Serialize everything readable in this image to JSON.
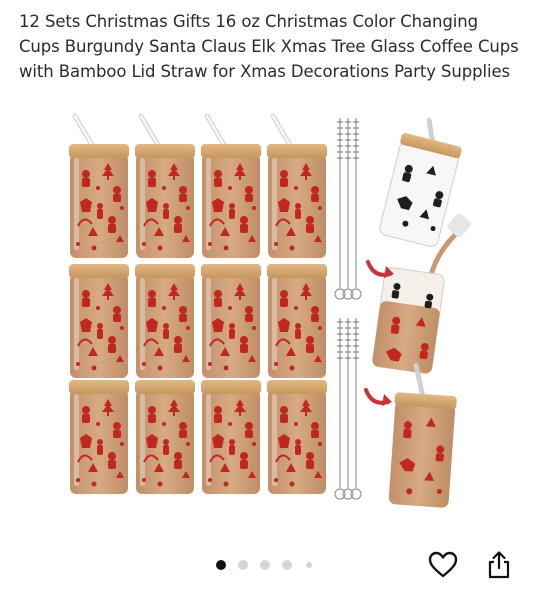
{
  "product": {
    "title": "12 Sets Christmas Gifts 16 oz Christmas Color Changing Cups Burgundy Santa Claus Elk Xmas Tree Glass Coffee Cups with Bamboo Lid Straw for Xmas Decorations Party Supplies"
  },
  "gallery": {
    "slide_count": 5,
    "active_index": 0
  },
  "icons": {
    "favorite": "heart-outline-icon",
    "share": "share-icon"
  },
  "colors": {
    "text": "#2b2b2b",
    "pattern_red": "#c0271f",
    "coffee": "#c99a72",
    "lid": "#d9ab72",
    "arrow_red": "#c8323b",
    "dot_active": "#111111",
    "dot_inactive": "#d6d6d6"
  }
}
